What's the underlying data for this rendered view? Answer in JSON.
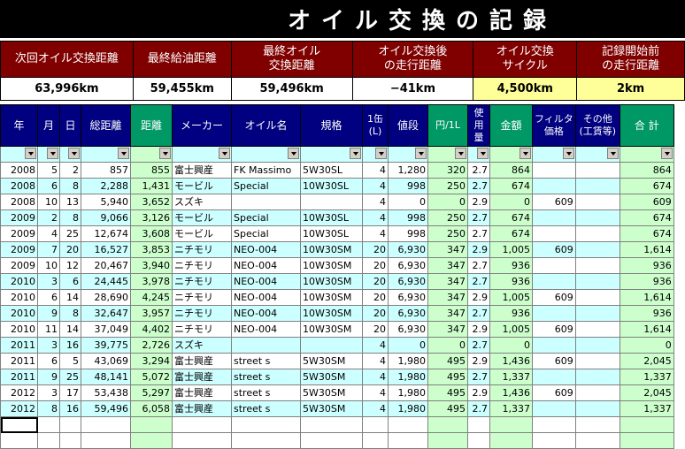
{
  "title": "オイル交換の記録",
  "summary": {
    "headers": [
      [
        "次回オイル交換距離"
      ],
      [
        "最終給油距離"
      ],
      [
        "最終オイル",
        "交換距離"
      ],
      [
        "オイル交換後",
        "の走行距離"
      ],
      [
        "オイル交換",
        "サイクル"
      ],
      [
        "記録開始前",
        "の走行距離"
      ]
    ],
    "values": [
      "63,996km",
      "59,455km",
      "59,496km",
      "−41km",
      "4,500km",
      "2km"
    ]
  },
  "table": {
    "headers": [
      "年",
      "月",
      "日",
      "総距離",
      "距離",
      "メーカー",
      "オイル名",
      "規格",
      "1缶",
      "(L)",
      "値段",
      "円/1L",
      "使",
      "用",
      "量",
      "金額",
      "フィルタ",
      "価格",
      "その他",
      "(工賃等)",
      "合 計"
    ],
    "rows": [
      [
        "2008",
        "5",
        "2",
        "857",
        "855",
        "富士興産",
        "FK Massimo",
        "5W30SL",
        "4",
        "1,280",
        "320",
        "2.7",
        "864",
        "",
        "864"
      ],
      [
        "2008",
        "6",
        "8",
        "2,288",
        "1,431",
        "モービル",
        "Special",
        "10W30SL",
        "4",
        "998",
        "250",
        "2.7",
        "674",
        "",
        "674"
      ],
      [
        "2008",
        "10",
        "13",
        "5,940",
        "3,652",
        "スズキ",
        "",
        "",
        "4",
        "0",
        "0",
        "2.9",
        "0",
        "609",
        "609"
      ],
      [
        "2009",
        "2",
        "8",
        "9,066",
        "3,126",
        "モービル",
        "Special",
        "10W30SL",
        "4",
        "998",
        "250",
        "2.7",
        "674",
        "",
        "674"
      ],
      [
        "2009",
        "4",
        "25",
        "12,674",
        "3,608",
        "モービル",
        "Special",
        "10W30SL",
        "4",
        "998",
        "250",
        "2.7",
        "674",
        "",
        "674"
      ],
      [
        "2009",
        "7",
        "20",
        "16,527",
        "3,853",
        "ニチモリ",
        "NEO-004",
        "10W30SM",
        "20",
        "6,930",
        "347",
        "2.9",
        "1,005",
        "609",
        "1,614"
      ],
      [
        "2009",
        "10",
        "12",
        "20,467",
        "3,940",
        "ニチモリ",
        "NEO-004",
        "10W30SM",
        "20",
        "6,930",
        "347",
        "2.7",
        "936",
        "",
        "936"
      ],
      [
        "2010",
        "3",
        "6",
        "24,445",
        "3,978",
        "ニチモリ",
        "NEO-004",
        "10W30SM",
        "20",
        "6,930",
        "347",
        "2.7",
        "936",
        "",
        "936"
      ],
      [
        "2010",
        "6",
        "14",
        "28,690",
        "4,245",
        "ニチモリ",
        "NEO-004",
        "10W30SM",
        "20",
        "6,930",
        "347",
        "2.9",
        "1,005",
        "609",
        "1,614"
      ],
      [
        "2010",
        "9",
        "8",
        "32,647",
        "3,957",
        "ニチモリ",
        "NEO-004",
        "10W30SM",
        "20",
        "6,930",
        "347",
        "2.7",
        "936",
        "",
        "936"
      ],
      [
        "2010",
        "11",
        "14",
        "37,049",
        "4,402",
        "ニチモリ",
        "NEO-004",
        "10W30SM",
        "20",
        "6,930",
        "347",
        "2.9",
        "1,005",
        "609",
        "1,614"
      ],
      [
        "2011",
        "3",
        "16",
        "39,775",
        "2,726",
        "スズキ",
        "",
        "",
        "4",
        "0",
        "0",
        "2.7",
        "0",
        "",
        "0"
      ],
      [
        "2011",
        "6",
        "5",
        "43,069",
        "3,294",
        "富士興産",
        "street s",
        "5W30SM",
        "4",
        "1,980",
        "495",
        "2.9",
        "1,436",
        "609",
        "2,045"
      ],
      [
        "2011",
        "9",
        "25",
        "48,141",
        "5,072",
        "富士興産",
        "street s",
        "5W30SM",
        "4",
        "1,980",
        "495",
        "2.7",
        "1,337",
        "",
        "1,337"
      ],
      [
        "2012",
        "3",
        "17",
        "53,438",
        "5,297",
        "富士興産",
        "street s",
        "5W30SM",
        "4",
        "1,980",
        "495",
        "2.9",
        "1,436",
        "609",
        "2,045"
      ],
      [
        "2012",
        "8",
        "16",
        "59,496",
        "6,058",
        "富士興産",
        "street s",
        "5W30SM",
        "4",
        "1,980",
        "495",
        "2.7",
        "1,337",
        "",
        "1,337"
      ]
    ]
  },
  "colors": {
    "title_bg": "#000000",
    "summary_header_bg": "#800000",
    "table_header_bg": "#000080",
    "green_header": "#009966",
    "cyan_row": "#ccffff",
    "green_cell": "#ccffcc",
    "yellow_cell": "#ffff99"
  }
}
